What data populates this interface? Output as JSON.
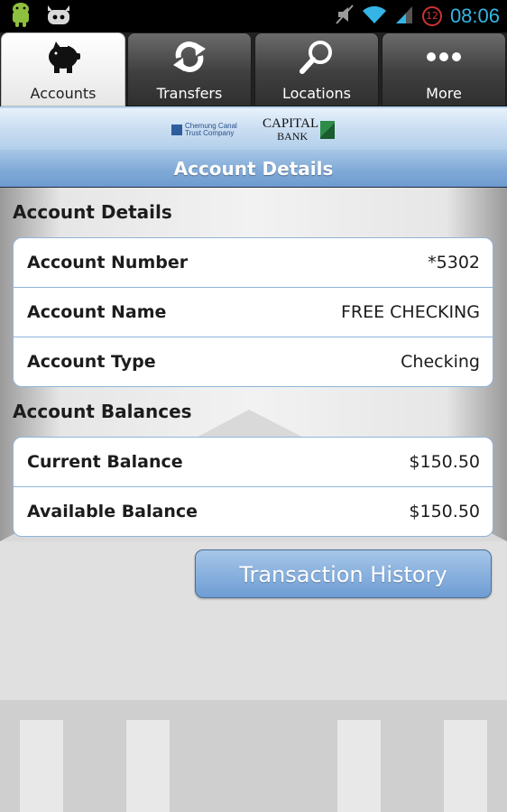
{
  "status_bar": {
    "time": "08:06",
    "notification_count": "12",
    "icons": [
      "android-robot-icon",
      "bbm-icon",
      "mute-icon",
      "wifi-icon",
      "signal-icon",
      "notification-badge-icon"
    ]
  },
  "tabs": [
    {
      "label": "Accounts",
      "icon": "piggy-bank-icon",
      "active": true
    },
    {
      "label": "Transfers",
      "icon": "transfer-arrows-icon",
      "active": false
    },
    {
      "label": "Locations",
      "icon": "search-icon",
      "active": false
    },
    {
      "label": "More",
      "icon": "more-dots-icon",
      "active": false
    }
  ],
  "logo": {
    "chemung_line1": "Chemung Canal",
    "chemung_line2": "Trust Company",
    "capital": "CAPITAL",
    "bank": "BANK"
  },
  "title": "Account Details",
  "account_details": {
    "heading": "Account Details",
    "rows": [
      {
        "label": "Account Number",
        "value": "*5302"
      },
      {
        "label": "Account Name",
        "value": "FREE CHECKING"
      },
      {
        "label": "Account Type",
        "value": "Checking"
      }
    ]
  },
  "account_balances": {
    "heading": "Account Balances",
    "rows": [
      {
        "label": "Current Balance",
        "value": "$150.50"
      },
      {
        "label": "Available Balance",
        "value": "$150.50"
      }
    ]
  },
  "transaction_history_label": "Transaction History",
  "colors": {
    "clock": "#35b5e5",
    "title_bar": "#7ea8d6",
    "card_border": "#8fb4da",
    "button": "#86afdd"
  }
}
